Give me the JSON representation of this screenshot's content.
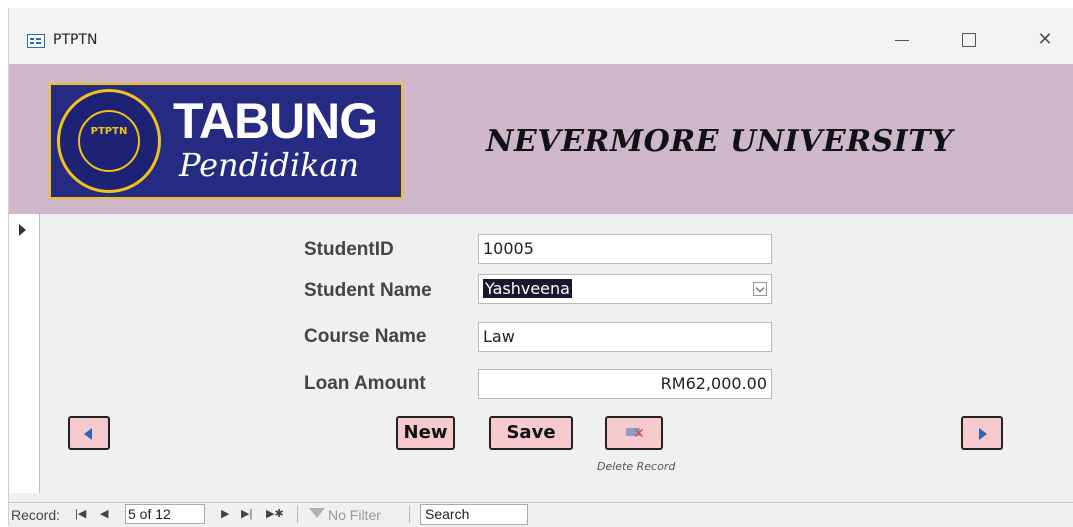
{
  "window": {
    "title": "PTPTN"
  },
  "header": {
    "logo_main": "TABUNG",
    "logo_sub": "Pendidikan",
    "logo_seal_text": "PTPTN",
    "university": "NEVERMORE UNIVERSITY",
    "background": "#cdb7c9"
  },
  "form": {
    "student_id": {
      "label": "StudentID",
      "value": "10005"
    },
    "student_name": {
      "label": "Student Name",
      "value": "Yashveena"
    },
    "course_name": {
      "label": "Course Name",
      "value": "Law"
    },
    "loan_amount": {
      "label": "Loan Amount",
      "value": "RM62,000.00"
    }
  },
  "buttons": {
    "new_label": "New",
    "save_label": "Save",
    "delete_caption": "Delete Record",
    "button_color": "#f6c9cf"
  },
  "status_bar": {
    "record_label": "Record:",
    "record_position": "5 of 12",
    "filter_label": "No Filter",
    "search_label": "Search"
  }
}
